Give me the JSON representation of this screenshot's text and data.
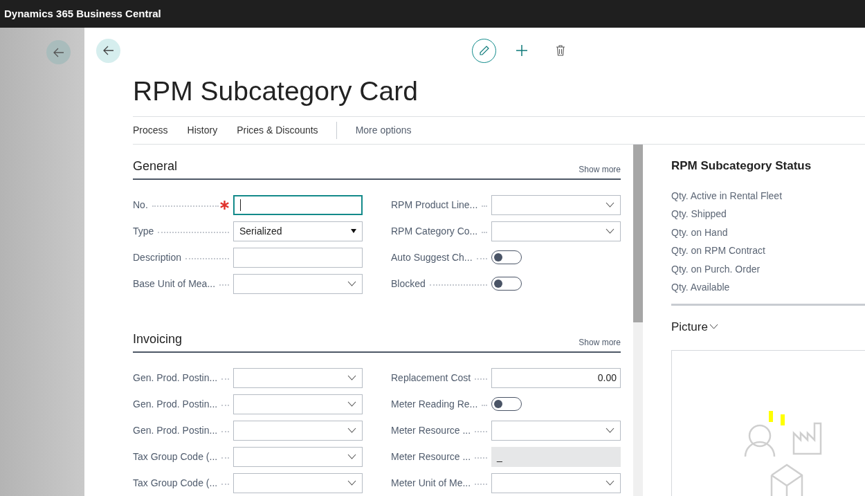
{
  "app_bar": {
    "title": "Dynamics 365 Business Central"
  },
  "page": {
    "title": "RPM Subcategory Card"
  },
  "action_bar": {
    "actions": [
      "Process",
      "History",
      "Prices & Discounts"
    ],
    "more": "More options"
  },
  "sections": [
    {
      "title": "General",
      "show_more": "Show more",
      "left": [
        {
          "label": "No.",
          "kind": "text",
          "focused": true,
          "required": true
        },
        {
          "label": "Type",
          "kind": "select",
          "value": "Serialized"
        },
        {
          "label": "Description",
          "kind": "text",
          "focused": false
        },
        {
          "label": "Base Unit of Mea...",
          "kind": "dropdown"
        }
      ],
      "right": [
        {
          "label": "RPM Product Line...",
          "kind": "dropdown"
        },
        {
          "label": "RPM Category Co...",
          "kind": "dropdown"
        },
        {
          "label": "Auto Suggest Ch...",
          "kind": "toggle",
          "on": false
        },
        {
          "label": "Blocked",
          "kind": "toggle",
          "on": false
        }
      ]
    },
    {
      "title": "Invoicing",
      "show_more": "Show more",
      "left": [
        {
          "label": "Gen. Prod. Postin...",
          "kind": "dropdown"
        },
        {
          "label": "Gen. Prod. Postin...",
          "kind": "dropdown"
        },
        {
          "label": "Gen. Prod. Postin...",
          "kind": "dropdown"
        },
        {
          "label": "Tax Group Code (...",
          "kind": "dropdown"
        },
        {
          "label": "Tax Group Code (...",
          "kind": "dropdown"
        }
      ],
      "right": [
        {
          "label": "Replacement Cost",
          "kind": "number",
          "value": "0.00"
        },
        {
          "label": "Meter Reading Re...",
          "kind": "toggle",
          "on": false
        },
        {
          "label": "Meter Resource ...",
          "kind": "dropdown"
        },
        {
          "label": "Meter Resource ...",
          "kind": "readonly",
          "value": "_"
        },
        {
          "label": "Meter Unit of Me...",
          "kind": "dropdown"
        }
      ]
    }
  ],
  "factbox": {
    "title": "RPM Subcategory Status",
    "fields": [
      "Qty. Active in Rental Fleet",
      "Qty. Shipped",
      "Qty. on Hand",
      "Qty. on RPM Contract",
      "Qty. on Purch. Order",
      "Qty. Available"
    ],
    "picture": {
      "title": "Picture"
    }
  }
}
